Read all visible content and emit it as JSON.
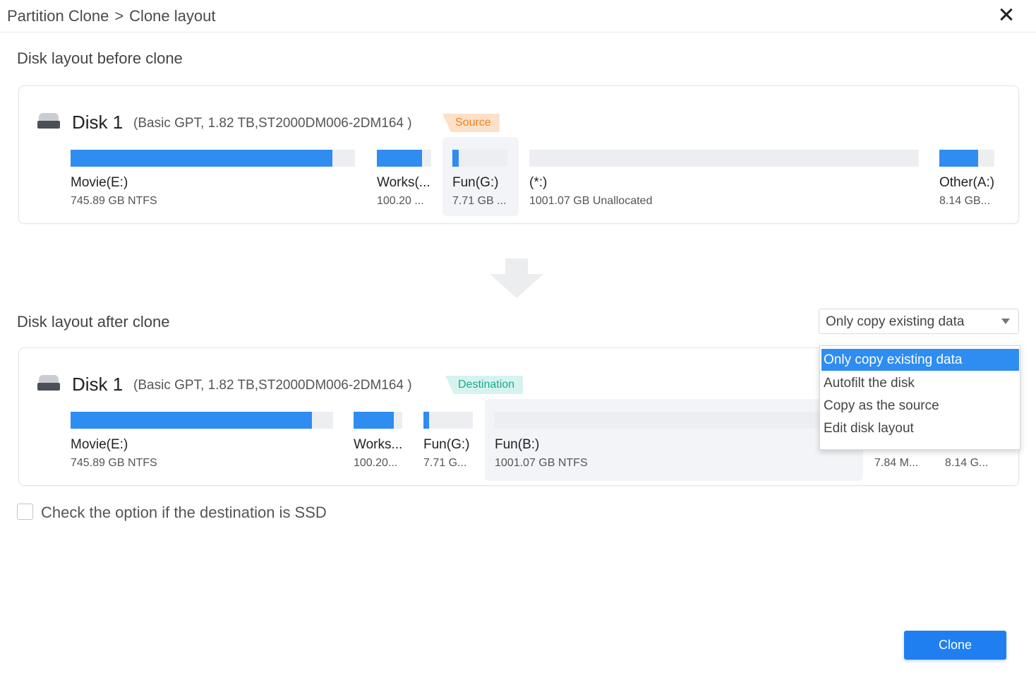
{
  "breadcrumb": {
    "parent": "Partition Clone",
    "separator": ">",
    "current": "Clone layout"
  },
  "before": {
    "section_title": "Disk layout before clone",
    "disk_name": "Disk 1",
    "disk_info": "(Basic GPT, 1.82 TB,ST2000DM006-2DM164 )",
    "tag": "Source",
    "partitions": [
      {
        "name": "Movie(E:)",
        "detail": "745.89 GB NTFS",
        "used_fraction": 0.92
      },
      {
        "name": "Works(...",
        "detail": "100.20 ...",
        "used_fraction": 0.83
      },
      {
        "name": "Fun(G:)",
        "detail": "7.71 GB ...",
        "used_fraction": 0.12
      },
      {
        "name": "(*:)",
        "detail": "1001.07 GB Unallocated",
        "used_fraction": 0
      },
      {
        "name": "Other(A:)",
        "detail": "8.14 GB...",
        "used_fraction": 0.71
      }
    ]
  },
  "after": {
    "section_title": "Disk layout after clone",
    "disk_name": "Disk 1",
    "disk_info": "(Basic GPT, 1.82 TB,ST2000DM006-2DM164 )",
    "tag": "Destination",
    "partitions": [
      {
        "name": "Movie(E:)",
        "detail": "745.89 GB NTFS",
        "used_fraction": 0.92
      },
      {
        "name": "Works...",
        "detail": "100.20...",
        "used_fraction": 0.83
      },
      {
        "name": "Fun(G:)",
        "detail": "7.71 G...",
        "used_fraction": 0.12
      },
      {
        "name": "Fun(B:)",
        "detail": "1001.07 GB NTFS",
        "used_fraction": 0
      },
      {
        "name": "",
        "detail": "7.84 M..."
      },
      {
        "name": "",
        "detail": "8.14 G..."
      }
    ]
  },
  "layout_select": {
    "value": "Only copy existing data",
    "options": [
      "Only copy existing data",
      "Autofilt the disk",
      "Copy as the source",
      "Edit disk layout"
    ],
    "selected_index": 0
  },
  "ssd_option": {
    "label": "Check the option if the destination is SSD",
    "checked": false
  },
  "clone_button": "Clone",
  "colors": {
    "accent": "#2f8cf0",
    "source_tag": "#f0811f",
    "destination_tag": "#1ea88f"
  }
}
